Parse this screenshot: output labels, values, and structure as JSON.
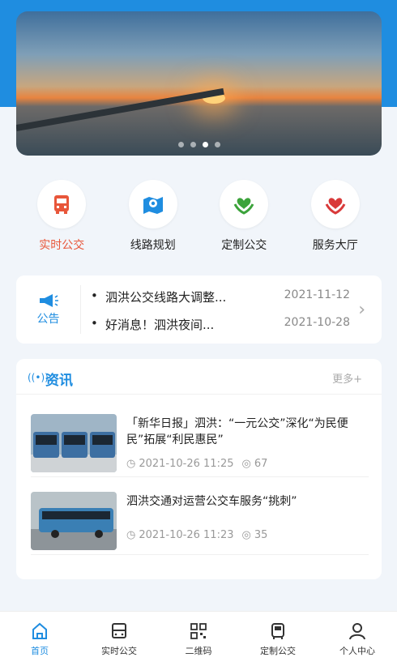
{
  "carousel": {
    "active_index": 2,
    "dot_count": 4
  },
  "quick_actions": [
    {
      "label": "实时公交",
      "icon": "bus-icon",
      "color": "#e8563a",
      "active": true
    },
    {
      "label": "线路规划",
      "icon": "map-pin-icon",
      "color": "#1f8de0",
      "active": false
    },
    {
      "label": "定制公交",
      "icon": "heart-hands-icon",
      "color": "#3ca33b",
      "active": false
    },
    {
      "label": "服务大厅",
      "icon": "heart-hands-icon",
      "color": "#d93a3a",
      "active": false
    }
  ],
  "notice": {
    "label": "公告",
    "items": [
      {
        "title": "泗洪公交线路大调整...",
        "date": "2021-11-12"
      },
      {
        "title": "好消息！泗洪夜间...",
        "date": "2021-10-28"
      }
    ]
  },
  "news": {
    "title": "资讯",
    "more": "更多+",
    "articles": [
      {
        "title": "「新华日报」泗洪：“一元公交”深化“为民便民”拓展“利民惠民”",
        "time": "2021-10-26 11:25",
        "views": "67"
      },
      {
        "title": "泗洪交通对运营公交车服务“挑刺”",
        "time": "2021-10-26 11:23",
        "views": "35"
      }
    ]
  },
  "tabs": [
    {
      "label": "首页",
      "icon": "home-icon",
      "active": true
    },
    {
      "label": "实时公交",
      "icon": "bus-icon",
      "active": false
    },
    {
      "label": "二维码",
      "icon": "qrcode-icon",
      "active": false
    },
    {
      "label": "定制公交",
      "icon": "bus-front-icon",
      "active": false
    },
    {
      "label": "个人中心",
      "icon": "user-icon",
      "active": false
    }
  ],
  "colors": {
    "accent": "#1f8de0",
    "active_red": "#e8563a"
  }
}
